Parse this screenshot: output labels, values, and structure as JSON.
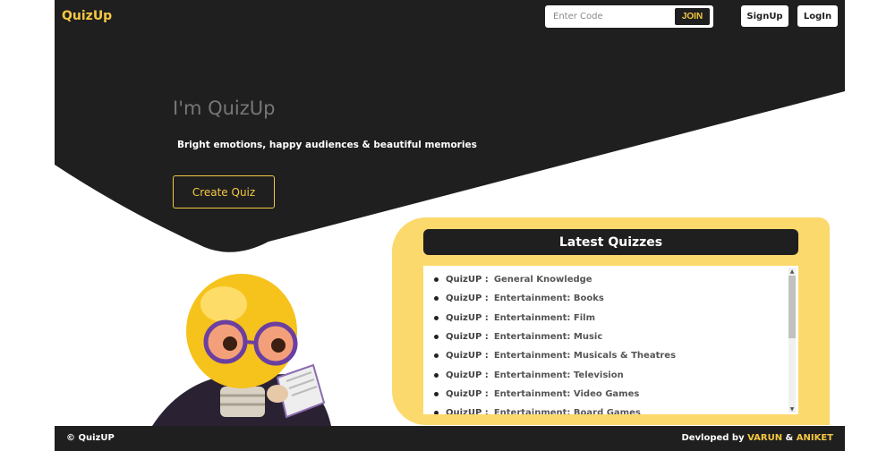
{
  "nav": {
    "brand": "QuizUp",
    "code_placeholder": "Enter Code",
    "join_label": "JOIN",
    "signup_label": "SignUp",
    "login_label": "LogIn"
  },
  "hero": {
    "title": "I'm QuizUp",
    "subtitle": "Bright emotions, happy audiences & beautiful memories",
    "create_label": "Create Quiz"
  },
  "latest": {
    "heading": "Latest Quizzes",
    "items": [
      {
        "prefix": "QuizUP :",
        "name": "General Knowledge"
      },
      {
        "prefix": "QuizUP :",
        "name": "Entertainment: Books"
      },
      {
        "prefix": "QuizUP :",
        "name": "Entertainment: Film"
      },
      {
        "prefix": "QuizUP :",
        "name": "Entertainment: Music"
      },
      {
        "prefix": "QuizUP :",
        "name": "Entertainment: Musicals & Theatres"
      },
      {
        "prefix": "QuizUP :",
        "name": "Entertainment: Television"
      },
      {
        "prefix": "QuizUP :",
        "name": "Entertainment: Video Games"
      },
      {
        "prefix": "QuizUP :",
        "name": "Entertainment: Board Games"
      }
    ]
  },
  "footer": {
    "copyright": "© QuizUP",
    "credit_prefix": "Devloped by ",
    "author1": "VARUN",
    "joiner": " & ",
    "author2": "ANIKET"
  },
  "colors": {
    "dark": "#1f1f1f",
    "accent": "#f5c842",
    "card": "#fcd96c"
  }
}
